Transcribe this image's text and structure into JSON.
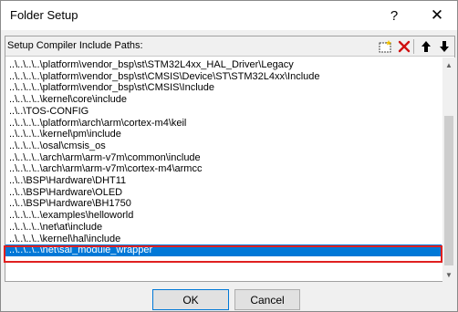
{
  "window": {
    "title": "Folder Setup",
    "help_glyph": "?",
    "close_glyph": "✕"
  },
  "panel": {
    "label": "Setup Compiler Include Paths:"
  },
  "toolbar": {
    "icons": [
      "new-folder-icon",
      "delete-icon",
      "move-up-icon",
      "move-down-icon"
    ]
  },
  "paths": [
    "..\\..\\..\\..\\platform\\vendor_bsp\\st\\STM32L4xx_HAL_Driver\\Legacy",
    "..\\..\\..\\..\\platform\\vendor_bsp\\st\\CMSIS\\Device\\ST\\STM32L4xx\\Include",
    "..\\..\\..\\..\\platform\\vendor_bsp\\st\\CMSIS\\Include",
    "..\\..\\..\\..\\kernel\\core\\include",
    "..\\..\\TOS-CONFIG",
    "..\\..\\..\\..\\platform\\arch\\arm\\cortex-m4\\keil",
    "..\\..\\..\\..\\kernel\\pm\\include",
    "..\\..\\..\\..\\osal\\cmsis_os",
    "..\\..\\..\\..\\arch\\arm\\arm-v7m\\common\\include",
    "..\\..\\..\\..\\arch\\arm\\arm-v7m\\cortex-m4\\armcc",
    "..\\..\\BSP\\Hardware\\DHT11",
    "..\\..\\BSP\\Hardware\\OLED",
    "..\\..\\BSP\\Hardware\\BH1750",
    "..\\..\\..\\..\\examples\\helloworld",
    "..\\..\\..\\..\\net\\at\\include",
    "..\\..\\..\\..\\kernel\\hal\\include",
    "..\\..\\..\\..\\net\\sal_module_wrapper"
  ],
  "selected_index": 16,
  "colors": {
    "selection": "#0078d7",
    "highlight_box": "#e02020"
  },
  "buttons": {
    "ok": "OK",
    "cancel": "Cancel"
  }
}
